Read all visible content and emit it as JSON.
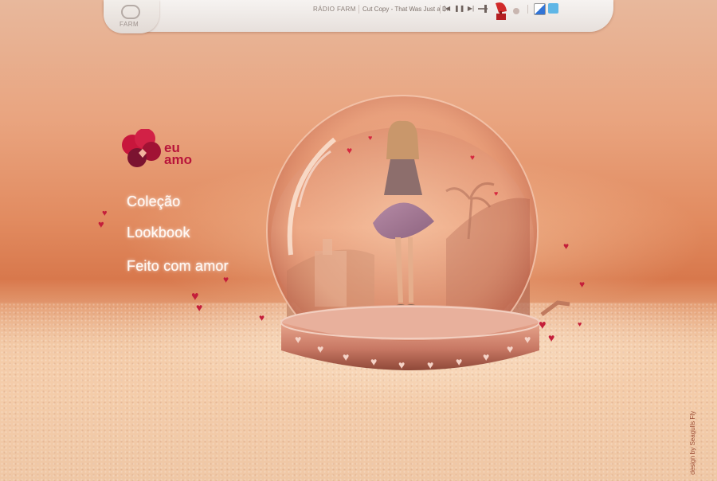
{
  "topbar": {
    "logo_text": "FARM",
    "radio_label": "RÁDIO FARM",
    "track": "Cut Copy - That Was Just a Dr",
    "controls": {
      "prev": "|◀",
      "pause": "❚❚",
      "next": "▶|"
    },
    "icons": [
      "farm-logo-icon",
      "gramophone-icon",
      "delicious-icon",
      "twitter-icon"
    ]
  },
  "menu": {
    "brand_line1": "eu",
    "brand_line2": "amo",
    "items": [
      "Coleção",
      "Lookbook",
      "Feito com amor"
    ]
  },
  "credit": "design by Seagulls Fly",
  "colors": {
    "accent": "#b8143a",
    "heart": "#d6283f",
    "background": "#e28c61"
  }
}
